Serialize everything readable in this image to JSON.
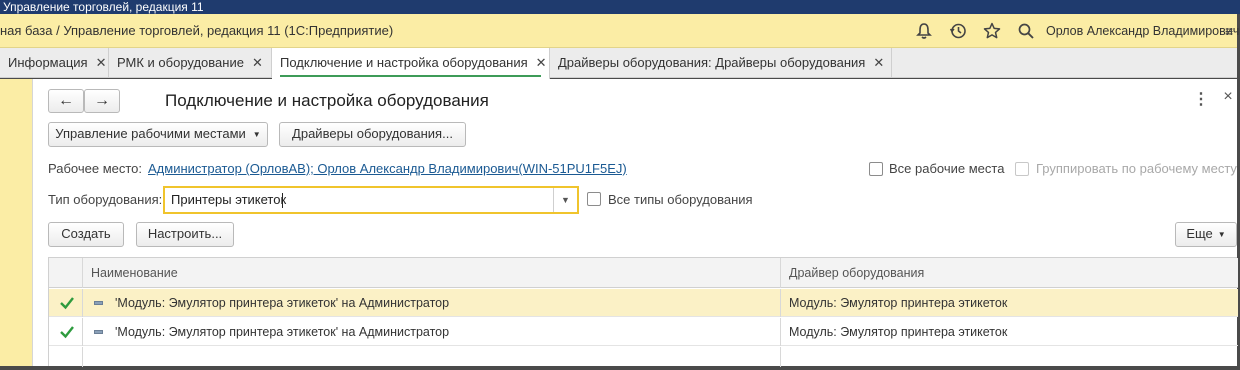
{
  "window": {
    "title": "Управление торговлей, редакция 11"
  },
  "appbar": {
    "title": "ная база / Управление торговлей, редакция 11  (1С:Предприятие)",
    "icons": [
      "bell-icon",
      "history-icon",
      "star-icon",
      "search-icon"
    ],
    "user": "Орлов Александр Владимирович"
  },
  "tabs": [
    {
      "label": "Информация",
      "active": false
    },
    {
      "label": "РМК и оборудование",
      "active": false
    },
    {
      "label": "Подключение и настройка оборудования",
      "active": true
    },
    {
      "label": "Драйверы оборудования: Драйверы оборудования",
      "active": false
    }
  ],
  "form": {
    "title": "Подключение и настройка оборудования",
    "nav_back": "←",
    "nav_forward": "→",
    "more_icon": "⋮",
    "close_icon": "×",
    "btn_workplaces": "Управление рабочими местами",
    "btn_drivers": "Драйверы оборудования...",
    "workplace_label": "Рабочее место:",
    "workplace_value": "Администратор (ОрловАВ); Орлов Александр Владимирович(WIN-51PU1F5EJ)",
    "all_workplaces": "Все рабочие места",
    "group_by_workplace": "Группировать по рабочему месту",
    "type_label": "Тип оборудования:",
    "type_value": "Принтеры этикеток",
    "all_types": "Все типы оборудования",
    "btn_create": "Создать",
    "btn_configure": "Настроить...",
    "btn_more": "Еще"
  },
  "table": {
    "columns": [
      "Наименование",
      "Драйвер оборудования"
    ],
    "rows": [
      {
        "name": "'Модуль: Эмулятор принтера этикеток' на Администратор",
        "driver": "Модуль: Эмулятор принтера этикеток",
        "checked": true,
        "selected": true
      },
      {
        "name": "'Модуль: Эмулятор принтера этикеток' на Администратор",
        "driver": "Модуль: Эмулятор принтера этикеток",
        "checked": true,
        "selected": false
      }
    ]
  }
}
